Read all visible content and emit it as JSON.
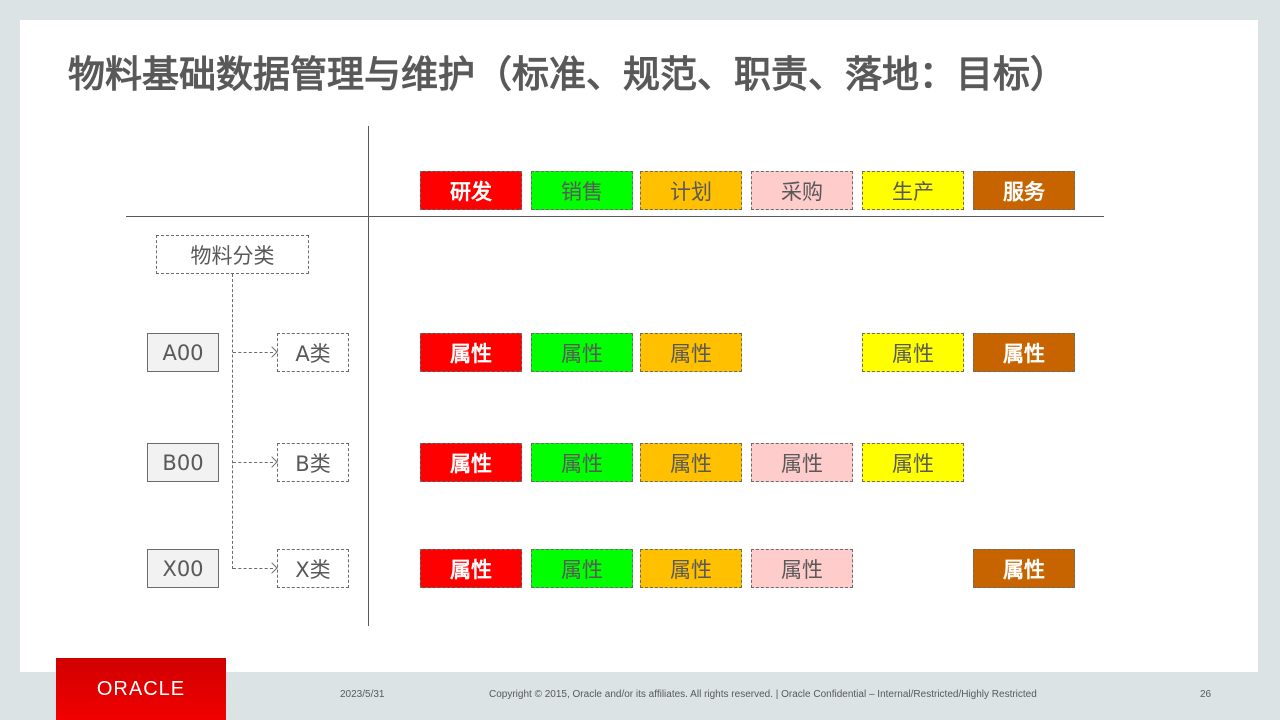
{
  "title": "物料基础数据管理与维护（标准、规范、职责、落地：目标）",
  "departments": [
    {
      "label": "研发",
      "color": "#ff0000",
      "bold": true
    },
    {
      "label": "销售",
      "color": "#00ff00",
      "bold": false
    },
    {
      "label": "计划",
      "color": "#ffc000",
      "bold": false
    },
    {
      "label": "采购",
      "color": "#ffcccc",
      "bold": false
    },
    {
      "label": "生产",
      "color": "#ffff00",
      "bold": false
    },
    {
      "label": "服务",
      "color": "#c86400",
      "bold": true
    }
  ],
  "tree": {
    "root": "物料分类",
    "codes": [
      "A00",
      "B00",
      "X00"
    ],
    "classes": [
      "A类",
      "B类",
      "X类"
    ]
  },
  "attribute_label": "属性",
  "attribute_rows": [
    {
      "code": "A00",
      "present": [
        true,
        true,
        true,
        false,
        true,
        true
      ]
    },
    {
      "code": "B00",
      "present": [
        true,
        true,
        true,
        true,
        true,
        false
      ]
    },
    {
      "code": "X00",
      "present": [
        true,
        true,
        true,
        true,
        false,
        true
      ]
    }
  ],
  "footer": {
    "logo": "ORACLE",
    "date": "2023/5/31",
    "copyright": "Copyright © 2015, Oracle and/or its affiliates. All rights reserved. |  Oracle Confidential – Internal/Restricted/Highly Restricted",
    "page_number": "26"
  }
}
